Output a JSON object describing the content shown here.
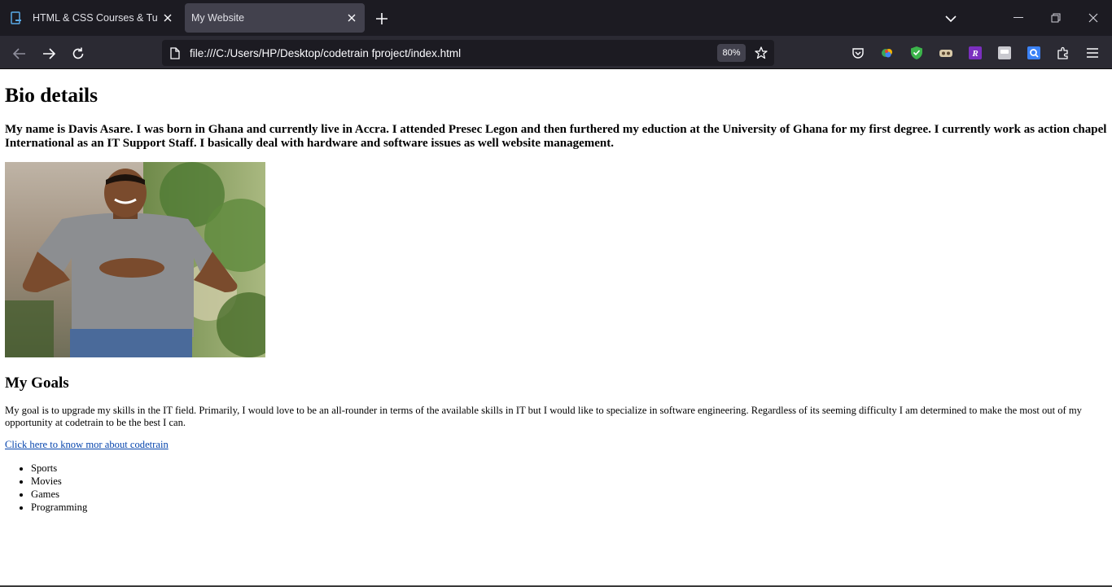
{
  "browser": {
    "tabs": [
      {
        "title": "HTML & CSS Courses & Tutorials",
        "active": false
      },
      {
        "title": "My Website",
        "active": true
      }
    ],
    "url": "file:///C:/Users/HP/Desktop/codetrain fproject/index.html",
    "zoom": "80%",
    "icons": {
      "back": "arrow-left-icon",
      "forward": "arrow-right-icon",
      "reload": "reload-icon",
      "page": "page-icon",
      "bookmark": "star-icon",
      "new_tab": "plus-icon",
      "tab_list": "chevron-down-icon"
    },
    "extensions": [
      "pocket-icon",
      "color-extension-icon",
      "shield-icon",
      "extension-icon",
      "r-extension-icon",
      "gray-extension-icon",
      "q-extension-icon",
      "puzzle-icon",
      "menu-icon"
    ]
  },
  "page": {
    "title": "Bio details",
    "bio": "My name is Davis Asare. I was born in Ghana and currently live in Accra. I attended Presec Legon and then furthered my eduction at the University of Ghana for my first degree. I currently work as action chapel International as an IT Support Staff. I basically deal with hardware and software issues as well website management.",
    "goals_heading": "My Goals",
    "goals_text": "My goal is to upgrade my skills in the IT field. Primarily, I would love to be an all-rounder in terms of the available skills in IT but I would like to specialize in software engineering. Regardless of its seeming difficulty I am determined to make the most out of my opportunity at codetrain to be the best I can.",
    "link_text": "Click here to know mor about codetrain",
    "hobbies": [
      "Sports",
      "Movies",
      "Games",
      "Programming"
    ]
  },
  "colors": {
    "tabbar_bg": "#1c1b22",
    "navbar_bg": "#2b2a33",
    "active_tab_bg": "#42414d",
    "link": "#0645ad"
  }
}
